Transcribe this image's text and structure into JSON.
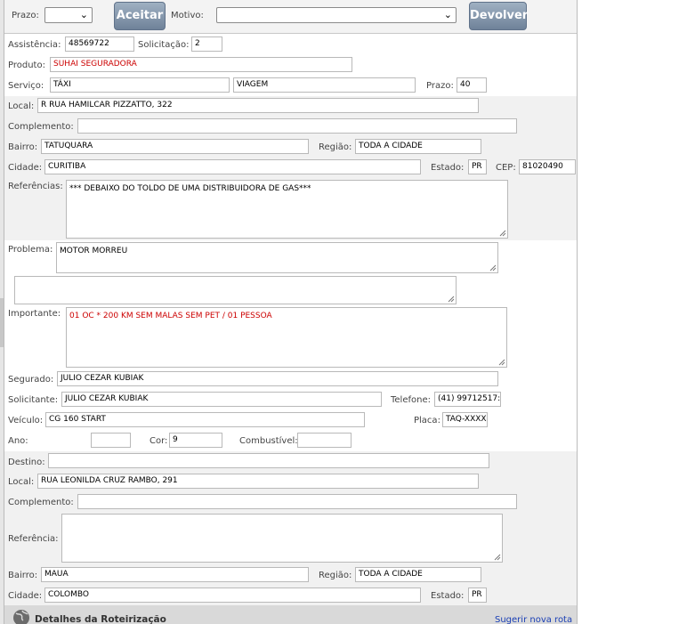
{
  "toolbar": {
    "prazo_label": "Prazo:",
    "prazo_value": "",
    "aceitar_label": "Aceitar",
    "motivo_label": "Motivo:",
    "motivo_value": "",
    "devolver_label": "Devolver"
  },
  "header": {
    "assistencia_label": "Assistência:",
    "assistencia_value": "48569722",
    "solicitacao_label": "Solicitação:",
    "solicitacao_value": "2",
    "produto_label": "Produto:",
    "produto_value": "SUHAI SEGURADORA",
    "servico_label": "Serviço:",
    "servico_value1": "TÁXI",
    "servico_value2": "VIAGEM",
    "prazo_label": "Prazo:",
    "prazo_value": "40"
  },
  "origem": {
    "local_label": "Local:",
    "local_value": "R RUA HAMILCAR PIZZATTO, 322",
    "complemento_label": "Complemento:",
    "complemento_value": "",
    "bairro_label": "Bairro:",
    "bairro_value": "TATUQUARA",
    "regiao_label": "Região:",
    "regiao_value": "TODA A CIDADE",
    "cidade_label": "Cidade:",
    "cidade_value": "CURITIBA",
    "estado_label": "Estado:",
    "estado_value": "PR",
    "cep_label": "CEP:",
    "cep_value": "81020490",
    "referencias_label": "Referências:",
    "referencias_value": "*** DEBAIXO DO TOLDO DE UMA DISTRIBUIDORA DE GAS***"
  },
  "problema": {
    "problema_label": "Problema:",
    "problema_value": "MOTOR MORREU",
    "extra_value": "",
    "importante_label": "Importante:",
    "importante_value": "01 OC * 200 KM SEM MALAS SEM PET / 01 PESSOA"
  },
  "segurado": {
    "segurado_label": "Segurado:",
    "segurado_value": "JULIO CEZAR KUBIAK",
    "solicitante_label": "Solicitante:",
    "solicitante_value": "JULIO CEZAR KUBIAK",
    "telefone_label": "Telefone:",
    "telefone_value": "(41) 99712517:",
    "veiculo_label": "Veículo:",
    "veiculo_value": "CG 160 START",
    "placa_label": "Placa:",
    "placa_value": "TAQ-XXXX",
    "ano_label": "Ano:",
    "ano_value": "",
    "cor_label": "Cor:",
    "cor_value": "9",
    "combustivel_label": "Combustível:",
    "combustivel_value": ""
  },
  "destino": {
    "destino_label": "Destino:",
    "destino_value": "",
    "local_label": "Local:",
    "local_value": "RUA LEONILDA CRUZ RAMBO, 291",
    "complemento_label": "Complemento:",
    "complemento_value": "",
    "referencia_label": "Referência:",
    "referencia_value": "",
    "bairro_label": "Bairro:",
    "bairro_value": "MAUA",
    "regiao_label": "Região:",
    "regiao_value": "TODA A CIDADE",
    "cidade_label": "Cidade:",
    "cidade_value": "COLOMBO",
    "estado_label": "Estado:",
    "estado_value": "PR"
  },
  "footer": {
    "title": "Detalhes da Roteirização",
    "link": "Sugerir nova rota"
  },
  "icons": {
    "select_arrow": "chevron-down-icon",
    "resize_grip": "resize-grip-icon",
    "route": "globe-icon"
  }
}
